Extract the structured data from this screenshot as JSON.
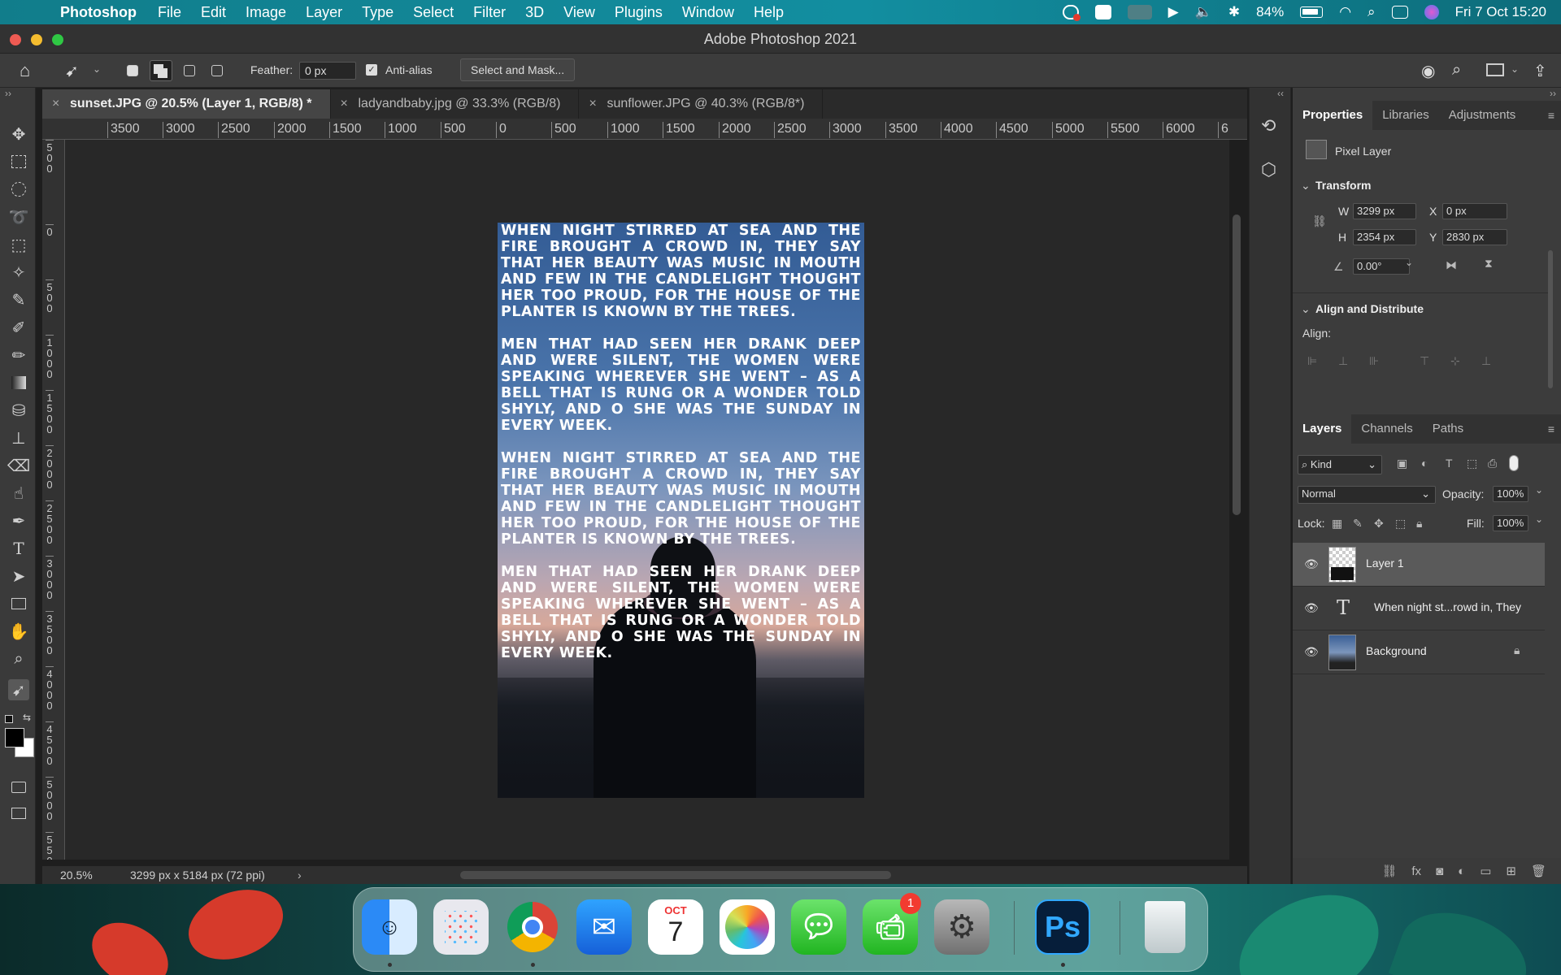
{
  "menubar": {
    "app": "Photoshop",
    "items": [
      "File",
      "Edit",
      "Image",
      "Layer",
      "Type",
      "Select",
      "Filter",
      "3D",
      "View",
      "Plugins",
      "Window",
      "Help"
    ],
    "battery": "84%",
    "datetime": "Fri 7 Oct  15:20"
  },
  "window": {
    "title": "Adobe Photoshop 2021"
  },
  "options": {
    "feather_label": "Feather:",
    "feather_value": "0 px",
    "antialias_label": "Anti-alias",
    "select_mask_label": "Select and Mask..."
  },
  "tabs": [
    {
      "label": "sunset.JPG @ 20.5% (Layer 1, RGB/8) *"
    },
    {
      "label": "ladyandbaby.jpg @ 33.3% (RGB/8)"
    },
    {
      "label": "sunflower.JPG @ 40.3% (RGB/8*)"
    }
  ],
  "ruler": {
    "h": [
      "3500",
      "3000",
      "2500",
      "2000",
      "1500",
      "1000",
      "500",
      "0",
      "500",
      "1000",
      "1500",
      "2000",
      "2500",
      "3000",
      "3500",
      "4000",
      "4500",
      "5000",
      "5500",
      "6000",
      "6"
    ],
    "v": [
      "500",
      "0",
      "500",
      "1000",
      "1500",
      "2000",
      "2500",
      "3000",
      "3500",
      "4000",
      "4500",
      "5000",
      "5500"
    ]
  },
  "document": {
    "text": "When night stirred at sea and the fire brought a crowd in, they say that her beauty was music in mouth and few in the candlelight thought her too proud, for the house of the planter is known by the trees.\n\nMen that had seen her drank deep and were silent, the women were speaking wherever she went – as a bell that is rung or a wonder told shyly, and O she was the Sunday in every week.\n\nWhen night stirred at sea and the fire brought a crowd in, they say that her beauty was music in mouth and few in the candlelight thought her too proud, for the house of the planter is known by the trees.\n\nMen that had seen her drank deep and were silent, the women were speaking wherever she went – as a bell that is rung or a wonder told shyly, and O she was the Sunday in every week."
  },
  "status": {
    "zoom": "20.5%",
    "size": "3299 px x 5184 px (72 ppi)"
  },
  "properties": {
    "tabs": [
      "Properties",
      "Libraries",
      "Adjustments"
    ],
    "kind": "Pixel Layer",
    "transform_title": "Transform",
    "w_label": "W",
    "w_value": "3299 px",
    "x_label": "X",
    "x_value": "0 px",
    "h_label": "H",
    "h_value": "2354 px",
    "y_label": "Y",
    "y_value": "2830 px",
    "angle_value": "0.00°",
    "align_title": "Align and Distribute",
    "align_label": "Align:"
  },
  "layers_panel": {
    "tabs": [
      "Layers",
      "Channels",
      "Paths"
    ],
    "filter_kind": "Kind",
    "blend_mode": "Normal",
    "opacity_label": "Opacity:",
    "opacity_value": "100%",
    "lock_label": "Lock:",
    "fill_label": "Fill:",
    "fill_value": "100%",
    "layers": [
      {
        "name": "Layer 1"
      },
      {
        "name": "When night st...rowd in, They"
      },
      {
        "name": "Background"
      }
    ]
  },
  "dock": {
    "calendar_month": "OCT",
    "calendar_day": "7",
    "facetime_badge": "1",
    "ps_label": "Ps"
  },
  "colors": {
    "accent": "#4a90d9",
    "panel": "#3c3c3c",
    "selected_layer": "#5a5a5a"
  }
}
